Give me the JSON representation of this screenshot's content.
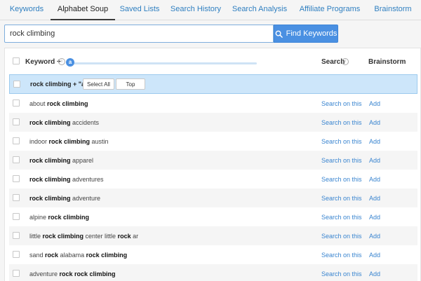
{
  "tabs": [
    {
      "label": "Keywords"
    },
    {
      "label": "Alphabet Soup"
    },
    {
      "label": "Saved Lists"
    },
    {
      "label": "Search History"
    },
    {
      "label": "Search Analysis"
    },
    {
      "label": "Affiliate Programs"
    },
    {
      "label": "Brainstorm"
    }
  ],
  "active_tab": "Alphabet Soup",
  "search": {
    "value": "rock climbing",
    "button_label": "Find Keywords",
    "button_icon": "search-icon"
  },
  "table": {
    "col_keyword": "Keyword +",
    "col_search": "Search",
    "col_brainstorm": "Brainstorm",
    "slider_letter": "a",
    "selected_row": {
      "label": "rock climbing + \"a\"",
      "select_all": "Select All",
      "top": "Top"
    },
    "row_search_label": "Search on this",
    "row_add_label": "Add",
    "rows": [
      [
        {
          "t": "about ",
          "b": false
        },
        {
          "t": "rock climbing",
          "b": true
        }
      ],
      [
        {
          "t": "rock climbing",
          "b": true
        },
        {
          "t": " accidents",
          "b": false
        }
      ],
      [
        {
          "t": "indoor ",
          "b": false
        },
        {
          "t": "rock climbing",
          "b": true
        },
        {
          "t": " austin",
          "b": false
        }
      ],
      [
        {
          "t": "rock climbing",
          "b": true
        },
        {
          "t": " apparel",
          "b": false
        }
      ],
      [
        {
          "t": "rock climbing",
          "b": true
        },
        {
          "t": " adventures",
          "b": false
        }
      ],
      [
        {
          "t": "rock climbing",
          "b": true
        },
        {
          "t": " adventure",
          "b": false
        }
      ],
      [
        {
          "t": "alpine ",
          "b": false
        },
        {
          "t": "rock climbing",
          "b": true
        }
      ],
      [
        {
          "t": "little ",
          "b": false
        },
        {
          "t": "rock climbing",
          "b": true
        },
        {
          "t": " center little ",
          "b": false
        },
        {
          "t": "rock",
          "b": true
        },
        {
          "t": " ar",
          "b": false
        }
      ],
      [
        {
          "t": "sand ",
          "b": false
        },
        {
          "t": "rock",
          "b": true
        },
        {
          "t": " alabama ",
          "b": false
        },
        {
          "t": "rock climbing",
          "b": true
        }
      ],
      [
        {
          "t": "adventure ",
          "b": false
        },
        {
          "t": "rock rock climbing",
          "b": true
        }
      ]
    ]
  },
  "colors": {
    "accent": "#4a90e2",
    "link": "#3a85d0",
    "selected_bg": "#cde6fa"
  }
}
